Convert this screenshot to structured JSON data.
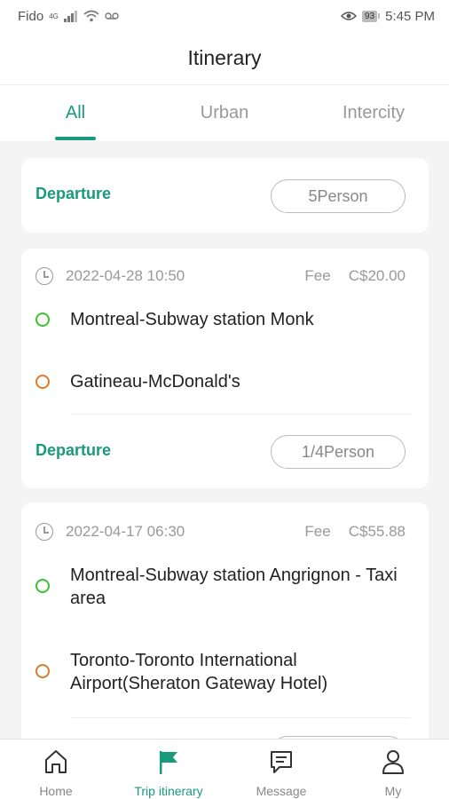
{
  "status_bar": {
    "carrier": "Fido",
    "network": "4G",
    "battery": "93",
    "time": "5:45 PM"
  },
  "header": {
    "title": "Itinerary"
  },
  "tabs": [
    {
      "label": "All",
      "active": true
    },
    {
      "label": "Urban",
      "active": false
    },
    {
      "label": "Intercity",
      "active": false
    }
  ],
  "summary_card": {
    "status": "Departure",
    "persons": "5Person"
  },
  "trips": [
    {
      "date": "2022-04-28 10:50",
      "fee_label": "Fee",
      "fee": "C$20.00",
      "origin": "Montreal-Subway station Monk",
      "destination": "Gatineau-McDonald's",
      "status": "Departure",
      "persons": "1/4Person"
    },
    {
      "date": "2022-04-17 06:30",
      "fee_label": "Fee",
      "fee": "C$55.88",
      "origin": "Montreal-Subway station Angrignon - Taxi area",
      "destination": "Toronto-Toronto International Airport(Sheraton Gateway Hotel)"
    }
  ],
  "bottom_nav": [
    {
      "label": "Home",
      "icon": "home-icon"
    },
    {
      "label": "Trip itinerary",
      "icon": "flag-icon",
      "active": true
    },
    {
      "label": "Message",
      "icon": "message-icon"
    },
    {
      "label": "My",
      "icon": "person-icon"
    }
  ],
  "colors": {
    "accent": "#1a9a7c",
    "origin_dot": "#39c133",
    "destination_dot": "#e07a2b"
  }
}
